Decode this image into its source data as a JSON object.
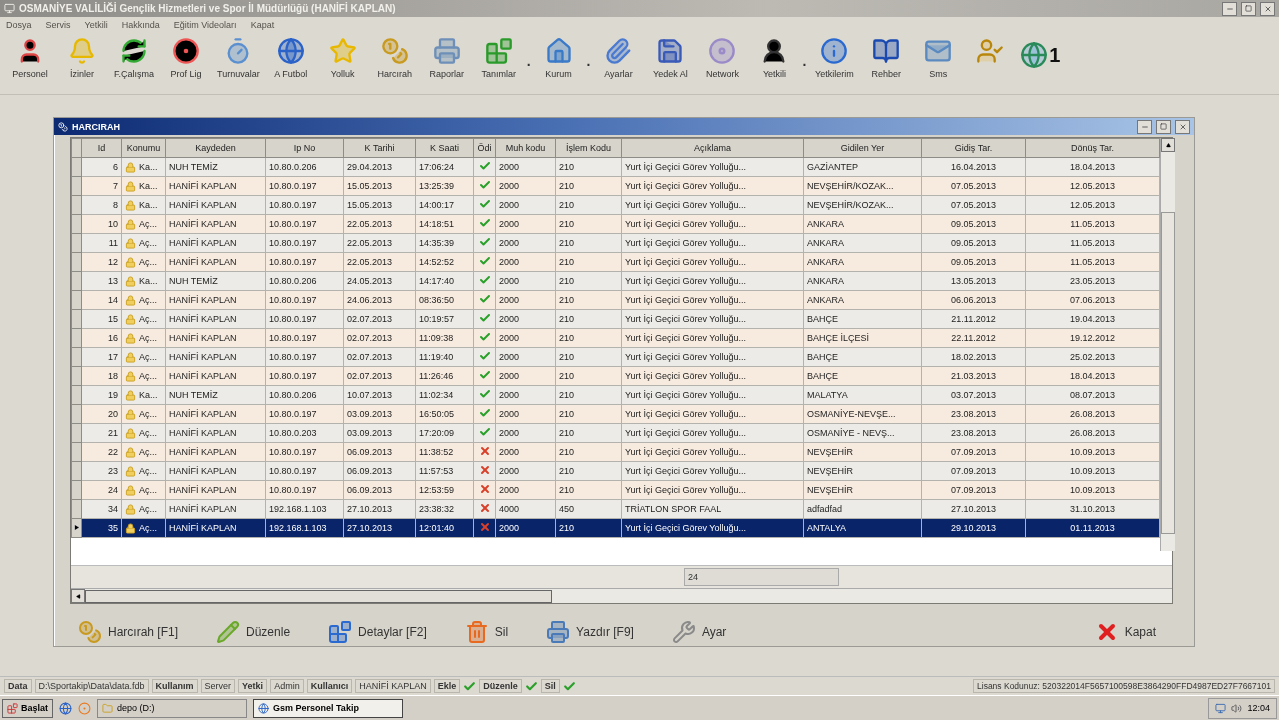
{
  "window": {
    "title": "OSMANİYE VALİLİĞİ Gençlik Hizmetleri ve Spor İl Müdürlüğü (HANİFİ KAPLAN)"
  },
  "menu": [
    "Dosya",
    "Servis",
    "Yetkili",
    "Hakkında",
    "Eğitim Videoları",
    "Kapat"
  ],
  "toolbar": [
    {
      "kind": "tool",
      "label": "Personel"
    },
    {
      "kind": "tool",
      "label": "İzinler"
    },
    {
      "kind": "tool",
      "label": "F.Çalışma"
    },
    {
      "kind": "tool",
      "label": "Prof Lig"
    },
    {
      "kind": "tool",
      "label": "Turnuvalar"
    },
    {
      "kind": "tool",
      "label": "A Futbol"
    },
    {
      "kind": "tool",
      "label": "Yolluk"
    },
    {
      "kind": "tool",
      "label": "Harcırah"
    },
    {
      "kind": "tool",
      "label": "Raporlar"
    },
    {
      "kind": "tool",
      "label": "Tanımlar"
    },
    {
      "kind": "dot",
      "label": "."
    },
    {
      "kind": "tool",
      "label": "Kurum"
    },
    {
      "kind": "dot",
      "label": "."
    },
    {
      "kind": "tool",
      "label": "Ayarlar"
    },
    {
      "kind": "tool",
      "label": "Yedek Al"
    },
    {
      "kind": "tool",
      "label": "Network"
    },
    {
      "kind": "tool",
      "label": "Yetkili"
    },
    {
      "kind": "dot",
      "label": "."
    },
    {
      "kind": "tool",
      "label": "Yetkilerim"
    },
    {
      "kind": "tool",
      "label": "Rehber"
    },
    {
      "kind": "tool",
      "label": "Sms"
    },
    {
      "kind": "user"
    },
    {
      "kind": "online",
      "label": "1"
    }
  ],
  "child_window": {
    "title": "HARCIRAH"
  },
  "table": {
    "columns": [
      "Id",
      "Konumu",
      "Kaydeden",
      "Ip No",
      "K Tarihi",
      "K Saati",
      "Ödi",
      "Muh kodu",
      "İşlem Kodu",
      "Açıklama",
      "Gidilen Yer",
      "Gidiş Tar.",
      "Dönüş Tar."
    ],
    "rows": [
      {
        "id": "6",
        "konumu": "Ka...",
        "kaydeden": "NUH TEMİZ",
        "ip": "10.80.0.206",
        "k_tarihi": "29.04.2013",
        "k_saati": "17:06:24",
        "paid": true,
        "muh_kodu": "2000",
        "islem_kodu": "210",
        "aciklama": "Yurt İçi Geçici Görev Yolluğu...",
        "gidilen": "GAZİANTEP",
        "gidis": "16.04.2013",
        "donus": "18.04.2013",
        "selected": false
      },
      {
        "id": "7",
        "konumu": "Ka...",
        "kaydeden": "HANİFİ KAPLAN",
        "ip": "10.80.0.197",
        "k_tarihi": "15.05.2013",
        "k_saati": "13:25:39",
        "paid": true,
        "muh_kodu": "2000",
        "islem_kodu": "210",
        "aciklama": "Yurt İçi Geçici Görev Yolluğu...",
        "gidilen": "NEVŞEHİR/KOZAK...",
        "gidis": "07.05.2013",
        "donus": "12.05.2013",
        "selected": false
      },
      {
        "id": "8",
        "konumu": "Ka...",
        "kaydeden": "HANİFİ KAPLAN",
        "ip": "10.80.0.197",
        "k_tarihi": "15.05.2013",
        "k_saati": "14:00:17",
        "paid": true,
        "muh_kodu": "2000",
        "islem_kodu": "210",
        "aciklama": "Yurt İçi Geçici Görev Yolluğu...",
        "gidilen": "NEVŞEHİR/KOZAK...",
        "gidis": "07.05.2013",
        "donus": "12.05.2013",
        "selected": false
      },
      {
        "id": "10",
        "konumu": "Aç...",
        "kaydeden": "HANİFİ KAPLAN",
        "ip": "10.80.0.197",
        "k_tarihi": "22.05.2013",
        "k_saati": "14:18:51",
        "paid": true,
        "muh_kodu": "2000",
        "islem_kodu": "210",
        "aciklama": "Yurt İçi Geçici Görev Yolluğu...",
        "gidilen": "ANKARA",
        "gidis": "09.05.2013",
        "donus": "11.05.2013",
        "selected": false
      },
      {
        "id": "11",
        "konumu": "Aç...",
        "kaydeden": "HANİFİ KAPLAN",
        "ip": "10.80.0.197",
        "k_tarihi": "22.05.2013",
        "k_saati": "14:35:39",
        "paid": true,
        "muh_kodu": "2000",
        "islem_kodu": "210",
        "aciklama": "Yurt İçi Geçici Görev Yolluğu...",
        "gidilen": "ANKARA",
        "gidis": "09.05.2013",
        "donus": "11.05.2013",
        "selected": false
      },
      {
        "id": "12",
        "konumu": "Aç...",
        "kaydeden": "HANİFİ KAPLAN",
        "ip": "10.80.0.197",
        "k_tarihi": "22.05.2013",
        "k_saati": "14:52:52",
        "paid": true,
        "muh_kodu": "2000",
        "islem_kodu": "210",
        "aciklama": "Yurt İçi Geçici Görev Yolluğu...",
        "gidilen": "ANKARA",
        "gidis": "09.05.2013",
        "donus": "11.05.2013",
        "selected": false
      },
      {
        "id": "13",
        "konumu": "Ka...",
        "kaydeden": "NUH TEMİZ",
        "ip": "10.80.0.206",
        "k_tarihi": "24.05.2013",
        "k_saati": "14:17:40",
        "paid": true,
        "muh_kodu": "2000",
        "islem_kodu": "210",
        "aciklama": "Yurt İçi Geçici Görev Yolluğu...",
        "gidilen": "ANKARA",
        "gidis": "13.05.2013",
        "donus": "23.05.2013",
        "selected": false
      },
      {
        "id": "14",
        "konumu": "Aç...",
        "kaydeden": "HANİFİ KAPLAN",
        "ip": "10.80.0.197",
        "k_tarihi": "24.06.2013",
        "k_saati": "08:36:50",
        "paid": true,
        "muh_kodu": "2000",
        "islem_kodu": "210",
        "aciklama": "Yurt İçi Geçici Görev Yolluğu...",
        "gidilen": "ANKARA",
        "gidis": "06.06.2013",
        "donus": "07.06.2013",
        "selected": false
      },
      {
        "id": "15",
        "konumu": "Aç...",
        "kaydeden": "HANİFİ KAPLAN",
        "ip": "10.80.0.197",
        "k_tarihi": "02.07.2013",
        "k_saati": "10:19:57",
        "paid": true,
        "muh_kodu": "2000",
        "islem_kodu": "210",
        "aciklama": "Yurt İçi Geçici Görev Yolluğu...",
        "gidilen": "BAHÇE",
        "gidis": "21.11.2012",
        "donus": "19.04.2013",
        "selected": false
      },
      {
        "id": "16",
        "konumu": "Aç...",
        "kaydeden": "HANİFİ KAPLAN",
        "ip": "10.80.0.197",
        "k_tarihi": "02.07.2013",
        "k_saati": "11:09:38",
        "paid": true,
        "muh_kodu": "2000",
        "islem_kodu": "210",
        "aciklama": "Yurt İçi Geçici Görev Yolluğu...",
        "gidilen": "BAHÇE İLÇESİ",
        "gidis": "22.11.2012",
        "donus": "19.12.2012",
        "selected": false
      },
      {
        "id": "17",
        "konumu": "Aç...",
        "kaydeden": "HANİFİ KAPLAN",
        "ip": "10.80.0.197",
        "k_tarihi": "02.07.2013",
        "k_saati": "11:19:40",
        "paid": true,
        "muh_kodu": "2000",
        "islem_kodu": "210",
        "aciklama": "Yurt İçi Geçici Görev Yolluğu...",
        "gidilen": "BAHÇE",
        "gidis": "18.02.2013",
        "donus": "25.02.2013",
        "selected": false
      },
      {
        "id": "18",
        "konumu": "Aç...",
        "kaydeden": "HANİFİ KAPLAN",
        "ip": "10.80.0.197",
        "k_tarihi": "02.07.2013",
        "k_saati": "11:26:46",
        "paid": true,
        "muh_kodu": "2000",
        "islem_kodu": "210",
        "aciklama": "Yurt İçi Geçici Görev Yolluğu...",
        "gidilen": "BAHÇE",
        "gidis": "21.03.2013",
        "donus": "18.04.2013",
        "selected": false
      },
      {
        "id": "19",
        "konumu": "Ka...",
        "kaydeden": "NUH TEMİZ",
        "ip": "10.80.0.206",
        "k_tarihi": "10.07.2013",
        "k_saati": "11:02:34",
        "paid": true,
        "muh_kodu": "2000",
        "islem_kodu": "210",
        "aciklama": "Yurt İçi Geçici Görev Yolluğu...",
        "gidilen": "MALATYA",
        "gidis": "03.07.2013",
        "donus": "08.07.2013",
        "selected": false
      },
      {
        "id": "20",
        "konumu": "Aç...",
        "kaydeden": "HANİFİ KAPLAN",
        "ip": "10.80.0.197",
        "k_tarihi": "03.09.2013",
        "k_saati": "16:50:05",
        "paid": true,
        "muh_kodu": "2000",
        "islem_kodu": "210",
        "aciklama": "Yurt İçi Geçici Görev Yolluğu...",
        "gidilen": "OSMANİYE-NEVŞE...",
        "gidis": "23.08.2013",
        "donus": "26.08.2013",
        "selected": false
      },
      {
        "id": "21",
        "konumu": "Aç...",
        "kaydeden": "HANİFİ KAPLAN",
        "ip": "10.80.0.203",
        "k_tarihi": "03.09.2013",
        "k_saati": "17:20:09",
        "paid": true,
        "muh_kodu": "2000",
        "islem_kodu": "210",
        "aciklama": "Yurt İçi Geçici Görev Yolluğu...",
        "gidilen": "OSMANİYE - NEVŞ...",
        "gidis": "23.08.2013",
        "donus": "26.08.2013",
        "selected": false
      },
      {
        "id": "22",
        "konumu": "Aç...",
        "kaydeden": "HANİFİ KAPLAN",
        "ip": "10.80.0.197",
        "k_tarihi": "06.09.2013",
        "k_saati": "11:38:52",
        "paid": false,
        "muh_kodu": "2000",
        "islem_kodu": "210",
        "aciklama": "Yurt İçi Geçici Görev Yolluğu...",
        "gidilen": "NEVŞEHİR",
        "gidis": "07.09.2013",
        "donus": "10.09.2013",
        "selected": false
      },
      {
        "id": "23",
        "konumu": "Aç...",
        "kaydeden": "HANİFİ KAPLAN",
        "ip": "10.80.0.197",
        "k_tarihi": "06.09.2013",
        "k_saati": "11:57:53",
        "paid": false,
        "muh_kodu": "2000",
        "islem_kodu": "210",
        "aciklama": "Yurt İçi Geçici Görev Yolluğu...",
        "gidilen": "NEVŞEHİR",
        "gidis": "07.09.2013",
        "donus": "10.09.2013",
        "selected": false
      },
      {
        "id": "24",
        "konumu": "Aç...",
        "kaydeden": "HANİFİ KAPLAN",
        "ip": "10.80.0.197",
        "k_tarihi": "06.09.2013",
        "k_saati": "12:53:59",
        "paid": false,
        "muh_kodu": "2000",
        "islem_kodu": "210",
        "aciklama": "Yurt İçi Geçici Görev Yolluğu...",
        "gidilen": "NEVŞEHİR",
        "gidis": "07.09.2013",
        "donus": "10.09.2013",
        "selected": false
      },
      {
        "id": "34",
        "konumu": "Aç...",
        "kaydeden": "HANİFİ KAPLAN",
        "ip": "192.168.1.103",
        "k_tarihi": "27.10.2013",
        "k_saati": "23:38:32",
        "paid": false,
        "muh_kodu": "4000",
        "islem_kodu": "450",
        "aciklama": "TRİATLON SPOR FAAL",
        "gidilen": "adfadfad",
        "gidis": "27.10.2013",
        "donus": "31.10.2013",
        "selected": false
      },
      {
        "id": "35",
        "konumu": "Aç...",
        "kaydeden": "HANİFİ KAPLAN",
        "ip": "192.168.1.103",
        "k_tarihi": "27.10.2013",
        "k_saati": "12:01:40",
        "paid": false,
        "muh_kodu": "2000",
        "islem_kodu": "210",
        "aciklama": "Yurt İçi Geçici Görev Yolluğu...",
        "gidilen": "ANTALYA",
        "gidis": "29.10.2013",
        "donus": "01.11.2013",
        "selected": true
      }
    ],
    "footer_count": "24"
  },
  "actions": [
    {
      "kind": "money",
      "label": "Harcırah [F1]"
    },
    {
      "kind": "edit",
      "label": "Düzenle"
    },
    {
      "kind": "details",
      "label": "Detaylar [F2]"
    },
    {
      "kind": "delete",
      "label": "Sil"
    },
    {
      "kind": "print",
      "label": "Yazdır [F9]"
    },
    {
      "kind": "settings",
      "label": "Ayar"
    },
    {
      "kind": "close",
      "label": "Kapat"
    }
  ],
  "status_bar": {
    "fields": [
      {
        "text": "Data",
        "bold": true
      },
      {
        "text": "D:\\Sportakip\\Data\\data.fdb",
        "bold": false
      },
      {
        "text": "Kullanım",
        "bold": true
      },
      {
        "text": "Server",
        "bold": false
      },
      {
        "text": "Yetki",
        "bold": true
      },
      {
        "text": "Admin",
        "bold": false
      },
      {
        "text": "Kullanıcı",
        "bold": true
      },
      {
        "text": "HANİFİ KAPLAN",
        "bold": false
      }
    ],
    "permissions": [
      {
        "label": "Ekle",
        "granted": true
      },
      {
        "label": "Düzenle",
        "granted": true
      },
      {
        "label": "Sil",
        "granted": true
      }
    ],
    "license": "Lisans Kodunuz: 520322014F5657100598E3864290FFD4987ED27F7667101"
  },
  "taskbar": {
    "start": "Başlat",
    "tasks": [
      {
        "label": "depo (D:)",
        "selected": false
      },
      {
        "label": "Gsm Personel Takip",
        "selected": true
      }
    ],
    "clock": "12:04"
  }
}
